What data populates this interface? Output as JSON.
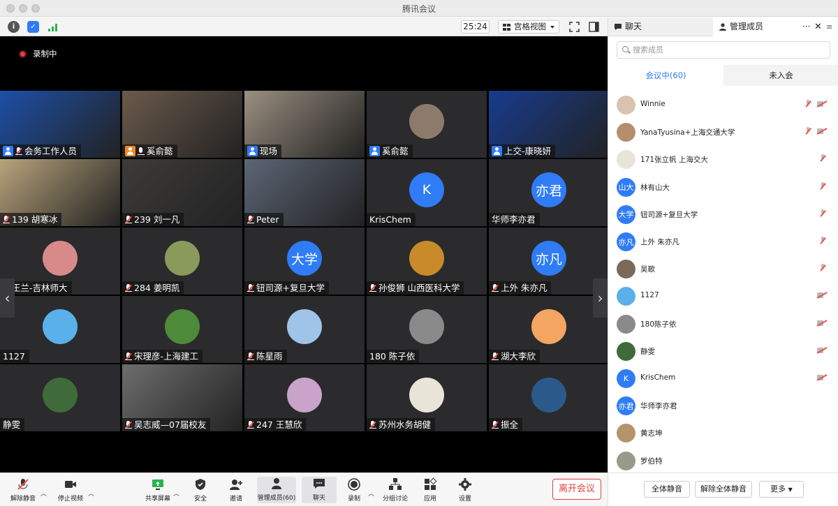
{
  "window": {
    "title": "腾讯会议"
  },
  "toolbar": {
    "timer": "25:24",
    "view_mode": "宫格视图"
  },
  "recording": {
    "label": "录制中"
  },
  "tiles": [
    {
      "name": "会务工作人员",
      "kind": "video",
      "bg": "#1d4fa8",
      "icon": "user"
    },
    {
      "name": "奚俞懿",
      "kind": "video",
      "bg": "#6b5a4b",
      "icon": "user-orange"
    },
    {
      "name": "现场",
      "kind": "video",
      "bg": "#9a8f80",
      "icon": "user"
    },
    {
      "name": "奚俞懿",
      "kind": "avatar",
      "avbg": "#8c7b6a",
      "icon": "user"
    },
    {
      "name": "上交-康晓妍",
      "kind": "video",
      "bg": "#173c8f",
      "icon": "user"
    },
    {
      "name": "139 胡寒冰",
      "kind": "video",
      "bg": "#b9a37c",
      "icon": "mic-off"
    },
    {
      "name": "239 刘一凡",
      "kind": "video",
      "bg": "#3d3b3a",
      "icon": "mic-off"
    },
    {
      "name": "Peter",
      "kind": "video",
      "bg": "#5c6676",
      "icon": "mic-off"
    },
    {
      "name": "KrisChem",
      "kind": "avatar",
      "avtext": "K",
      "avbg": "#2f7cf6",
      "icon": "none"
    },
    {
      "name": "华师李亦君",
      "kind": "avatar",
      "avtext": "亦君",
      "avbg": "#2f7cf6",
      "icon": "none"
    },
    {
      "name": "王兰-吉林师大",
      "kind": "avatar",
      "avbg": "#d88a8a",
      "icon": "mic-off"
    },
    {
      "name": "284 姜明凯",
      "kind": "avatar",
      "avbg": "#8a9a5a",
      "icon": "mic-off"
    },
    {
      "name": "钮司源+复旦大学",
      "kind": "avatar",
      "avtext": "大学",
      "avbg": "#2f7cf6",
      "icon": "mic-off"
    },
    {
      "name": "孙俊狮 山西医科大学",
      "kind": "avatar",
      "avbg": "#c98a2a",
      "icon": "mic-off"
    },
    {
      "name": "上外 朱亦凡",
      "kind": "avatar",
      "avtext": "亦凡",
      "avbg": "#2f7cf6",
      "icon": "mic-off"
    },
    {
      "name": "1127",
      "kind": "avatar",
      "avbg": "#5ab0e8",
      "icon": "none"
    },
    {
      "name": "宋理彦-上海建工",
      "kind": "avatar",
      "avbg": "#4d8a3a",
      "icon": "mic-off"
    },
    {
      "name": "陈星雨",
      "kind": "avatar",
      "avbg": "#9fc4e8",
      "icon": "mic-off"
    },
    {
      "name": "180 陈子依",
      "kind": "avatar",
      "avbg": "#8a8a8a",
      "icon": "none"
    },
    {
      "name": "湖大李欣",
      "kind": "avatar",
      "avbg": "#f3a561",
      "icon": "mic-off"
    },
    {
      "name": "静雯",
      "kind": "avatar",
      "avbg": "#3f6a3a",
      "icon": "none"
    },
    {
      "name": "吴志威—07届校友",
      "kind": "video",
      "bg": "#6d6d6d",
      "icon": "mic-off"
    },
    {
      "name": "247 王慧欣",
      "kind": "avatar",
      "avbg": "#c9a3c9",
      "icon": "mic-off"
    },
    {
      "name": "苏州水务胡健",
      "kind": "avatar",
      "avbg": "#e9e4d8",
      "icon": "mic-off"
    },
    {
      "name": "振全",
      "kind": "avatar",
      "avbg": "#2b5a8a",
      "icon": "mic-off"
    }
  ],
  "controls": [
    {
      "label": "解除静音",
      "icon": "mic-muted-icon"
    },
    {
      "label": "停止视频",
      "icon": "video-camera-icon"
    },
    {
      "label": "共享屏幕",
      "icon": "share-screen-icon"
    },
    {
      "label": "安全",
      "icon": "shield-icon"
    },
    {
      "label": "邀请",
      "icon": "invite-icon"
    },
    {
      "label": "管理成员(60)",
      "icon": "members-icon"
    },
    {
      "label": "聊天",
      "icon": "chat-icon"
    },
    {
      "label": "录制",
      "icon": "record-icon"
    },
    {
      "label": "分组讨论",
      "icon": "breakout-icon"
    },
    {
      "label": "应用",
      "icon": "apps-icon"
    },
    {
      "label": "设置",
      "icon": "gear-icon"
    }
  ],
  "leave_label": "离开会议",
  "panel": {
    "tab_chat": "聊天",
    "tab_members": "管理成员",
    "search_placeholder": "搜索成员",
    "in_meeting_tab": "会议中(60)",
    "not_joined_tab": "未入会",
    "members": [
      {
        "name": "Winnie",
        "avbg": "#d9c2b0",
        "avtext": "",
        "mic_off": true,
        "cam_off": true
      },
      {
        "name": "YanaTyusina+上海交通大学",
        "avbg": "#b58e6b",
        "avtext": "",
        "mic_off": true,
        "cam_off": true
      },
      {
        "name": "171张立帆 上海交大",
        "avbg": "#e9e4d8",
        "avtext": "",
        "mic_off": true,
        "cam_off": false
      },
      {
        "name": "林有山大",
        "avbg": "#2f7cf6",
        "avtext": "山大",
        "mic_off": true,
        "cam_off": false
      },
      {
        "name": "钮司源+复旦大学",
        "avbg": "#2f7cf6",
        "avtext": "大学",
        "mic_off": true,
        "cam_off": false
      },
      {
        "name": "上外 朱亦凡",
        "avbg": "#2f7cf6",
        "avtext": "亦凡",
        "mic_off": true,
        "cam_off": false
      },
      {
        "name": "吴歌",
        "avbg": "#7a6a5a",
        "avtext": "",
        "mic_off": true,
        "cam_off": false
      },
      {
        "name": "1127",
        "avbg": "#5ab0e8",
        "avtext": "",
        "mic_off": false,
        "cam_off": true
      },
      {
        "name": "180陈子依",
        "avbg": "#8a8a8a",
        "avtext": "",
        "mic_off": false,
        "cam_off": true
      },
      {
        "name": "静雯",
        "avbg": "#3f6a3a",
        "avtext": "",
        "mic_off": false,
        "cam_off": true
      },
      {
        "name": "KrisChem",
        "avbg": "#2f7cf6",
        "avtext": "K",
        "mic_off": false,
        "cam_off": true
      },
      {
        "name": "华师李亦君",
        "avbg": "#2f7cf6",
        "avtext": "亦君",
        "mic_off": false,
        "cam_off": false
      },
      {
        "name": "黄志坤",
        "avbg": "#b5946b",
        "avtext": "",
        "mic_off": false,
        "cam_off": false
      },
      {
        "name": "罗伯特",
        "avbg": "#9a9a8a",
        "avtext": "",
        "mic_off": false,
        "cam_off": false
      }
    ],
    "btn_mute_all": "全体静音",
    "btn_unmute_all": "解除全体静音",
    "btn_more": "更多"
  }
}
